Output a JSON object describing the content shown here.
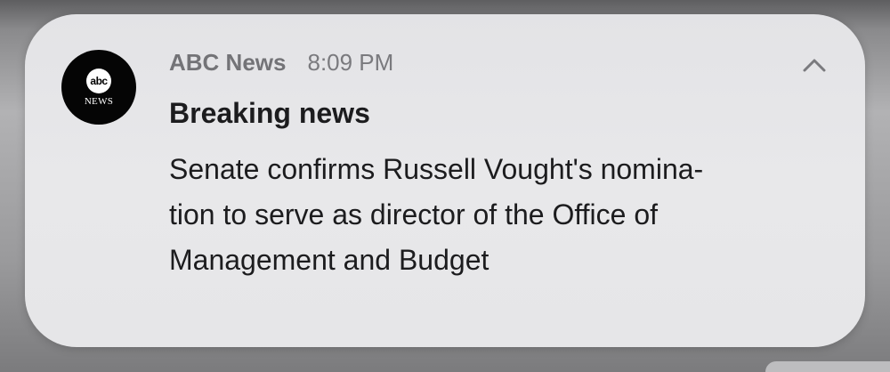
{
  "notification": {
    "app_icon": {
      "name": "abc-news-logo",
      "logo_text": "abc",
      "logo_subtext": "NEWS"
    },
    "app_name": "ABC News",
    "time": "8:09 PM",
    "title": "Breaking news",
    "body_lines": [
      "Senate confirms Russell Vought's nomina-",
      "tion to serve as director of the Office of",
      "Management and Budget"
    ],
    "collapse_icon": "chevron-up-icon"
  },
  "colors": {
    "card_background": "#e6e6e8",
    "icon_background": "#050505",
    "primary_text": "#1c1c1e",
    "secondary_text": "#7a7a7e"
  }
}
